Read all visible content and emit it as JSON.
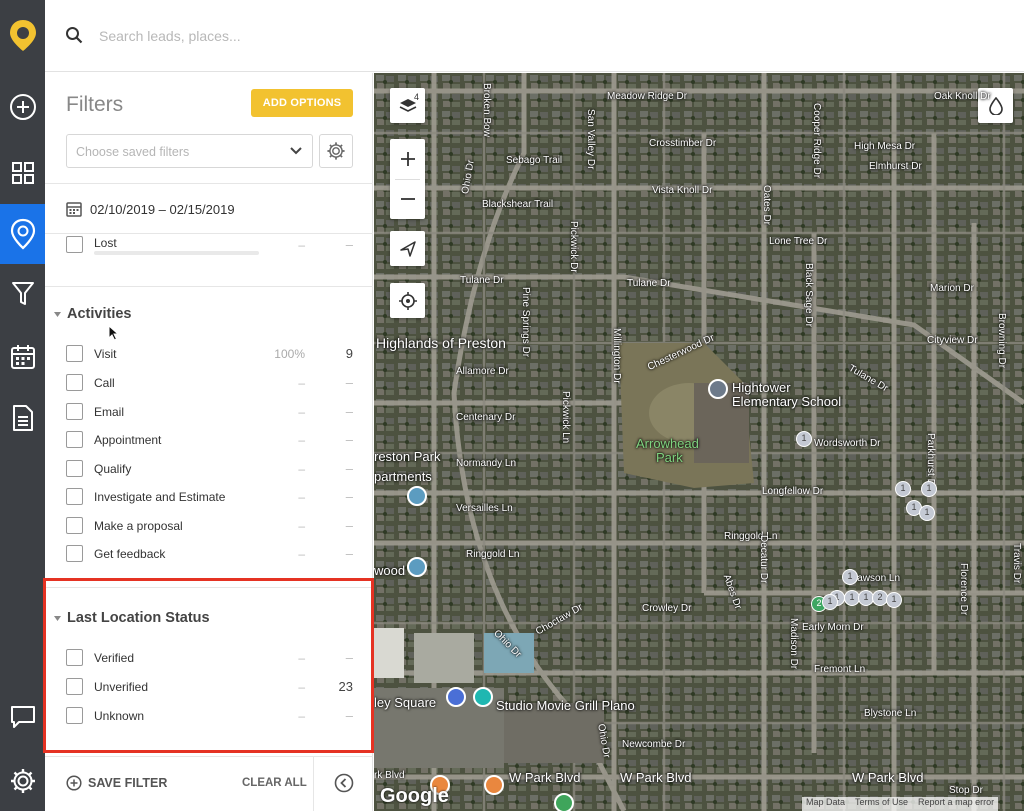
{
  "search": {
    "placeholder": "Search leads, places..."
  },
  "panel": {
    "title": "Filters",
    "add_options_label": "ADD OPTIONS",
    "saved_filters_placeholder": "Choose saved filters",
    "date_range": "02/10/2019 – 02/15/2019"
  },
  "lost_row": {
    "label": "Lost",
    "percent": "–",
    "count": "–"
  },
  "activities": {
    "title": "Activities",
    "items": [
      {
        "label": "Visit",
        "percent": "100%",
        "count": "9",
        "fill": 1.0
      },
      {
        "label": "Call",
        "percent": "–",
        "count": "–"
      },
      {
        "label": "Email",
        "percent": "–",
        "count": "–"
      },
      {
        "label": "Appointment",
        "percent": "–",
        "count": "–"
      },
      {
        "label": "Qualify",
        "percent": "–",
        "count": "–"
      },
      {
        "label": "Investigate and Estimate",
        "percent": "–",
        "count": "–"
      },
      {
        "label": "Make a proposal",
        "percent": "–",
        "count": "–"
      },
      {
        "label": "Get feedback",
        "percent": "–",
        "count": "–"
      }
    ]
  },
  "location_status": {
    "title": "Last Location Status",
    "items": [
      {
        "label": "Verified",
        "percent": "–",
        "count": "–"
      },
      {
        "label": "Unverified",
        "percent": "–",
        "count": "23"
      },
      {
        "label": "Unknown",
        "percent": "–",
        "count": "–"
      }
    ]
  },
  "footer": {
    "save_filter_label": "SAVE FILTER",
    "clear_all_label": "CLEAR ALL"
  },
  "map": {
    "layers_count": "4",
    "streets": {
      "meadow_ridge": "Meadow Ridge Dr",
      "oak_knoll": "Oak Knoll Dr",
      "broken_bow": "Broken Bow",
      "san_valley": "San Valley Dr",
      "sebago": "Sebago Trail",
      "crosstimber": "Crosstimber Dr",
      "high_mesa": "High Mesa Dr",
      "cooper_ridge": "Cooper Ridge Dr",
      "vista_knoll": "Vista Knoll Dr",
      "oates": "Oates Dr",
      "elmhurst": "Elmhurst Dr",
      "blackshear": "Blackshear Trail",
      "ohio_top": "Ohio Dr",
      "pickwick_top": "Pickwick Dr",
      "lone_tree": "Lone Tree Dr",
      "black_sage": "Black Sage Dr",
      "tulane_left": "Tulane Dr",
      "tulane_mid": "Tulane Dr",
      "tulane_right": "Tulane Dr",
      "pine_springs": "Pine Springs Dr",
      "millington": "Millington Dr",
      "marion": "Marion Dr",
      "cityview": "Cityview Dr",
      "browning": "Browning Dr",
      "allamore": "Allamore Dr",
      "chesterwood": "Chesterwood Dr",
      "centenary": "Centenary Dr",
      "pickwick_ln": "Pickwick Ln",
      "wordsworth": "Wordsworth Dr",
      "normandy": "Normandy Ln",
      "parkhurst": "Parkhurst Dr",
      "longfellow": "Longfellow Dr",
      "versailles": "Versailles Ln",
      "ringgold_left": "Ringgold Ln",
      "ringgold_right": "Ringgold Ln",
      "decatur": "Decatur Dr",
      "crowley": "Crowley Dr",
      "choctaw": "Choctaw Dr",
      "abes": "Abes Dr",
      "madison": "Madison Dr",
      "dawson": "Dawson Ln",
      "early_morn": "Early Morn Dr",
      "fremont": "Fremont Ln",
      "ohio_bottom": "Ohio Dr",
      "blystone": "Blystone Ln",
      "newcombe": "Newcombe Dr",
      "florence": "Florence Dr",
      "travis": "Travis Dr",
      "w_park_left": "W Park Blvd",
      "w_park_mid": "W Park Blvd",
      "w_park_right": "W Park Blvd",
      "rk_blvd": "rk Blvd",
      "ohio_mid": "Ohio Dr",
      "stop": "Stop Dr"
    },
    "places": {
      "highlands": "Highlands of Preston",
      "hightower_1": "Hightower",
      "hightower_2": "Elementary School",
      "arrowhead_1": "Arrowhead",
      "arrowhead_2": "Park",
      "preston_park_1": "reston Park",
      "preston_park_2": "partments",
      "wood": "wood",
      "ley_square": "ley Square",
      "studio_movie": "Studio Movie Grill Plano"
    },
    "pins": {
      "p1": "1",
      "p2": "1",
      "p3": "1",
      "p4": "1",
      "p5": "1",
      "p6": "1",
      "p7": "1",
      "p8": "1",
      "p9": "1",
      "p10": "2",
      "p11": "2",
      "p12": "1",
      "p13": "1"
    },
    "google_logo": "Google",
    "attribution": [
      "Map Data",
      "Terms of Use",
      "Report a map error"
    ]
  },
  "colors": {
    "accent": "#f2c230",
    "active_nav": "#1a73e8",
    "rail": "#3c3f44",
    "highlight_frame": "#e53223",
    "pin_green": "#3ea662"
  }
}
